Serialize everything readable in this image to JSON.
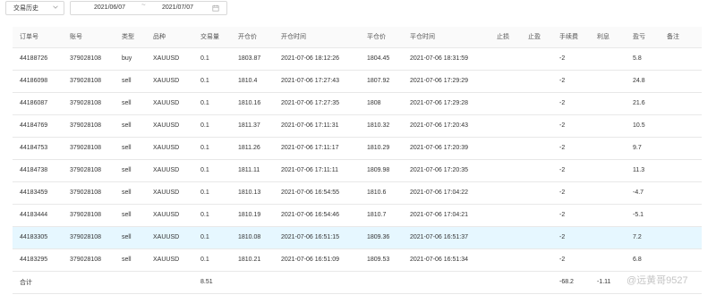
{
  "filter": {
    "type_value": "交易历史"
  },
  "date_range": {
    "start": "2021/06/07",
    "separator": "~",
    "end": "2021/07/07"
  },
  "columns": [
    "订单号",
    "账号",
    "类型",
    "品种",
    "交易量",
    "开仓价",
    "开仓时间",
    "平仓价",
    "平仓时间",
    "止损",
    "止盈",
    "手续费",
    "利息",
    "盈亏",
    "备注"
  ],
  "rows": [
    [
      "44188726",
      "379028108",
      "buy",
      "XAUUSD",
      "0.1",
      "1803.87",
      "2021-07-06 18:12:26",
      "1804.45",
      "2021-07-06 18:31:59",
      "",
      "",
      "-2",
      "",
      "5.8",
      ""
    ],
    [
      "44186098",
      "379028108",
      "sell",
      "XAUUSD",
      "0.1",
      "1810.4",
      "2021-07-06 17:27:43",
      "1807.92",
      "2021-07-06 17:29:29",
      "",
      "",
      "-2",
      "",
      "24.8",
      ""
    ],
    [
      "44186087",
      "379028108",
      "sell",
      "XAUUSD",
      "0.1",
      "1810.16",
      "2021-07-06 17:27:35",
      "1808",
      "2021-07-06 17:29:28",
      "",
      "",
      "-2",
      "",
      "21.6",
      ""
    ],
    [
      "44184769",
      "379028108",
      "sell",
      "XAUUSD",
      "0.1",
      "1811.37",
      "2021-07-06 17:11:31",
      "1810.32",
      "2021-07-06 17:20:43",
      "",
      "",
      "-2",
      "",
      "10.5",
      ""
    ],
    [
      "44184753",
      "379028108",
      "sell",
      "XAUUSD",
      "0.1",
      "1811.26",
      "2021-07-06 17:11:17",
      "1810.29",
      "2021-07-06 17:20:39",
      "",
      "",
      "-2",
      "",
      "9.7",
      ""
    ],
    [
      "44184738",
      "379028108",
      "sell",
      "XAUUSD",
      "0.1",
      "1811.11",
      "2021-07-06 17:11:11",
      "1809.98",
      "2021-07-06 17:20:35",
      "",
      "",
      "-2",
      "",
      "11.3",
      ""
    ],
    [
      "44183459",
      "379028108",
      "sell",
      "XAUUSD",
      "0.1",
      "1810.13",
      "2021-07-06 16:54:55",
      "1810.6",
      "2021-07-06 17:04:22",
      "",
      "",
      "-2",
      "",
      "-4.7",
      ""
    ],
    [
      "44183444",
      "379028108",
      "sell",
      "XAUUSD",
      "0.1",
      "1810.19",
      "2021-07-06 16:54:46",
      "1810.7",
      "2021-07-06 17:04:21",
      "",
      "",
      "-2",
      "",
      "-5.1",
      ""
    ],
    [
      "44183305",
      "379028108",
      "sell",
      "XAUUSD",
      "0.1",
      "1810.08",
      "2021-07-06 16:51:15",
      "1809.36",
      "2021-07-06 16:51:37",
      "",
      "",
      "-2",
      "",
      "7.2",
      ""
    ],
    [
      "44183295",
      "379028108",
      "sell",
      "XAUUSD",
      "0.1",
      "1810.21",
      "2021-07-06 16:51:09",
      "1809.53",
      "2021-07-06 16:51:34",
      "",
      "",
      "-2",
      "",
      "6.8",
      ""
    ]
  ],
  "highlighted_row_index": 8,
  "summary": {
    "label": "合计",
    "volume": "8.51",
    "fee": "-68.2",
    "interest": "-1.11",
    "profit": ""
  },
  "watermark": "@远黄哥9527",
  "colors": {
    "border": "#e8e8e8",
    "header_bg": "#fafafa",
    "highlight_row": "#e6f7ff",
    "text": "#333333"
  }
}
